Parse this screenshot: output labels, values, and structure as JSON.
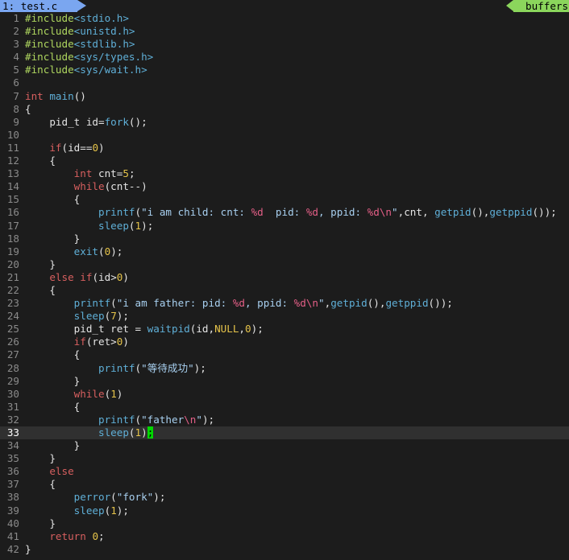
{
  "tabline": {
    "active_tab": "1: test.c",
    "buffers_label": "buffers"
  },
  "editor": {
    "current_line": 33,
    "colors": {
      "background": "#1c1c1c",
      "keyword": "#d75f5f",
      "preproc": "#afd75f",
      "function": "#5fafd7",
      "number": "#e5c34a",
      "string": "#a8d0f0",
      "escape": "#e45f87",
      "cursor": "#00d700"
    },
    "lines": [
      {
        "n": "1",
        "code": "#include<stdio.h>"
      },
      {
        "n": "2",
        "code": "#include<unistd.h>"
      },
      {
        "n": "3",
        "code": "#include<stdlib.h>"
      },
      {
        "n": "4",
        "code": "#include<sys/types.h>"
      },
      {
        "n": "5",
        "code": "#include<sys/wait.h>"
      },
      {
        "n": "6",
        "code": ""
      },
      {
        "n": "7",
        "code": "int main()"
      },
      {
        "n": "8",
        "code": "{"
      },
      {
        "n": "9",
        "code": "    pid_t id=fork();"
      },
      {
        "n": "10",
        "code": ""
      },
      {
        "n": "11",
        "code": "    if(id==0)"
      },
      {
        "n": "12",
        "code": "    {"
      },
      {
        "n": "13",
        "code": "        int cnt=5;"
      },
      {
        "n": "14",
        "code": "        while(cnt--)"
      },
      {
        "n": "15",
        "code": "        {"
      },
      {
        "n": "16",
        "code": "            printf(\"i am child: cnt: %d  pid: %d, ppid: %d\\n\",cnt, getpid(),getppid());"
      },
      {
        "n": "17",
        "code": "            sleep(1);"
      },
      {
        "n": "18",
        "code": "        }"
      },
      {
        "n": "19",
        "code": "        exit(0);"
      },
      {
        "n": "20",
        "code": "    }"
      },
      {
        "n": "21",
        "code": "    else if(id>0)"
      },
      {
        "n": "22",
        "code": "    {"
      },
      {
        "n": "23",
        "code": "        printf(\"i am father: pid: %d, ppid: %d\\n\",getpid(),getppid());"
      },
      {
        "n": "24",
        "code": "        sleep(7);"
      },
      {
        "n": "25",
        "code": "        pid_t ret = waitpid(id,NULL,0);"
      },
      {
        "n": "26",
        "code": "        if(ret>0)"
      },
      {
        "n": "27",
        "code": "        {"
      },
      {
        "n": "28",
        "code": "            printf(\"等待成功\");"
      },
      {
        "n": "29",
        "code": "        }"
      },
      {
        "n": "30",
        "code": "        while(1)"
      },
      {
        "n": "31",
        "code": "        {"
      },
      {
        "n": "32",
        "code": "            printf(\"father\\n\");"
      },
      {
        "n": "33",
        "code": "            sleep(1);"
      },
      {
        "n": "34",
        "code": "        }"
      },
      {
        "n": "35",
        "code": "    }"
      },
      {
        "n": "36",
        "code": "    else"
      },
      {
        "n": "37",
        "code": "    {"
      },
      {
        "n": "38",
        "code": "        perror(\"fork\");"
      },
      {
        "n": "39",
        "code": "        sleep(1);"
      },
      {
        "n": "40",
        "code": "    }"
      },
      {
        "n": "41",
        "code": "    return 0;"
      },
      {
        "n": "42",
        "code": "}"
      }
    ]
  }
}
